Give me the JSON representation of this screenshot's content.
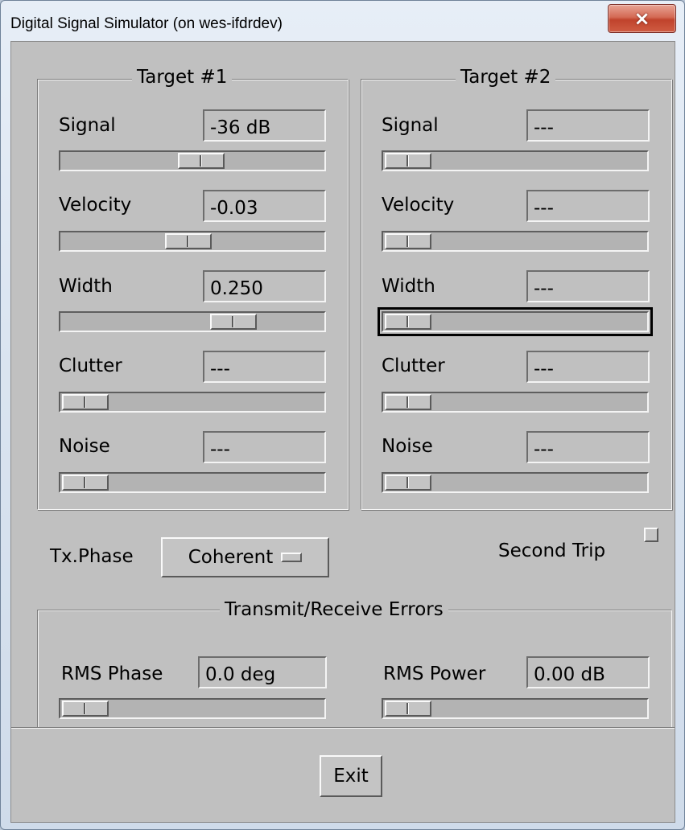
{
  "window": {
    "title": "Digital Signal Simulator (on wes-ifdrdev)",
    "close_icon": "×"
  },
  "target1": {
    "title": "Target #1",
    "signal_label": "Signal",
    "signal_value": "-36 dB",
    "signal_level": 0.54,
    "velocity_label": "Velocity",
    "velocity_value": "-0.03",
    "velocity_level": 0.48,
    "width_label": "Width",
    "width_value": "0.250",
    "width_level": 0.69,
    "clutter_label": "Clutter",
    "clutter_value": "---",
    "clutter_level": 0.0,
    "noise_label": "Noise",
    "noise_value": "---",
    "noise_level": 0.0
  },
  "target2": {
    "title": "Target #2",
    "signal_label": "Signal",
    "signal_value": "---",
    "signal_level": 0.0,
    "velocity_label": "Velocity",
    "velocity_value": "---",
    "velocity_level": 0.0,
    "width_label": "Width",
    "width_value": "---",
    "width_level": 0.0,
    "clutter_label": "Clutter",
    "clutter_value": "---",
    "clutter_level": 0.0,
    "noise_label": "Noise",
    "noise_value": "---",
    "noise_level": 0.0
  },
  "tx_phase": {
    "label": "Tx.Phase",
    "selected": "Coherent"
  },
  "second_trip": {
    "label": "Second Trip",
    "checked": false
  },
  "errors": {
    "title": "Transmit/Receive Errors",
    "rms_phase_label": "RMS Phase",
    "rms_phase_value": "0.0 deg",
    "rms_phase_level": 0.0,
    "rms_power_label": "RMS Power",
    "rms_power_value": "0.00 dB",
    "rms_power_level": 0.0
  },
  "exit_label": "Exit"
}
